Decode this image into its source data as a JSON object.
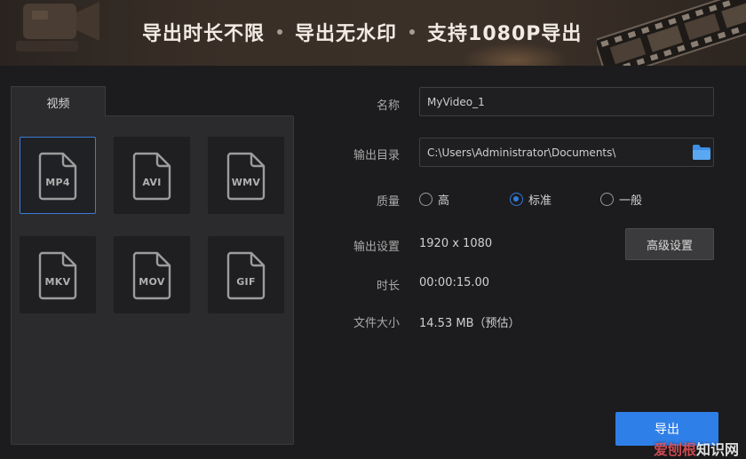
{
  "banner": {
    "features": [
      "导出时长不限",
      "导出无水印",
      "支持1080P导出"
    ]
  },
  "format_panel": {
    "tab_label": "视频",
    "formats": [
      "MP4",
      "AVI",
      "WMV",
      "MKV",
      "MOV",
      "GIF"
    ],
    "selected": "MP4"
  },
  "form": {
    "name_label": "名称",
    "name_value": "MyVideo_1",
    "output_dir_label": "输出目录",
    "output_dir_value": "C:\\Users\\Administrator\\Documents\\",
    "quality_label": "质量",
    "quality_options": [
      "高",
      "标准",
      "一般"
    ],
    "quality_selected": "标准",
    "output_settings_label": "输出设置",
    "resolution": "1920 x 1080",
    "advanced_button": "高级设置",
    "duration_label": "时长",
    "duration_value": "00:00:15.00",
    "filesize_label": "文件大小",
    "filesize_value": "14.53 MB（预估）",
    "export_button": "导出"
  },
  "watermark": {
    "brand_part": "爱刨根",
    "site_part": "知识网"
  },
  "colors": {
    "accent": "#2f7fe8",
    "selected_border": "#3d7ad6",
    "background": "#1c1c1e"
  }
}
